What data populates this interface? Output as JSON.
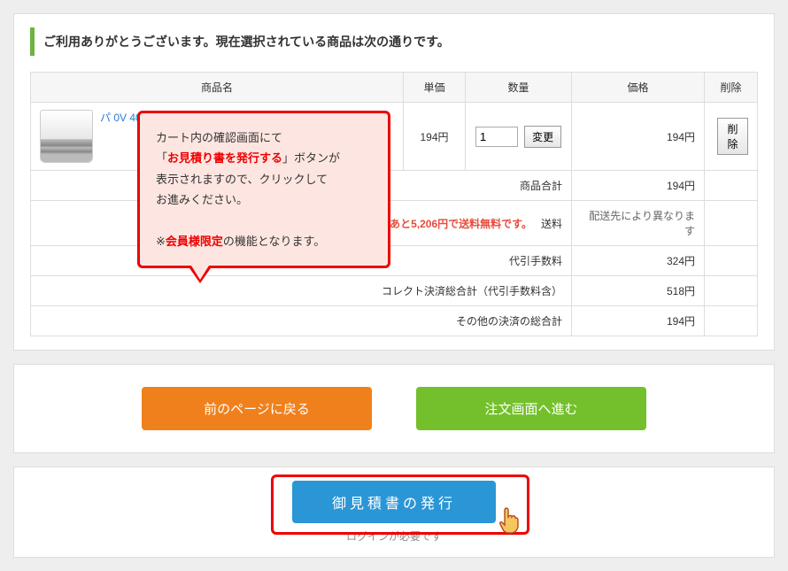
{
  "heading": "ご利用ありがとうございます。現在選択されている商品は次の通りです。",
  "table": {
    "headers": {
      "name": "商品名",
      "unit": "単価",
      "qty": "数量",
      "price": "価格",
      "del": "削除"
    },
    "item": {
      "name_visible": "パ                                                                                0V 40W形 ホワイ",
      "unit": "194円",
      "qty": "1",
      "change": "変更",
      "price": "194円",
      "del": "削除"
    },
    "summary": {
      "subtotal_label": "商品合計",
      "subtotal": "194円",
      "free_ship": "あと5,206円で送料無料です。",
      "ship_label": "送料",
      "ship_note": "配送先により異なります",
      "cod_label": "代引手数料",
      "cod": "324円",
      "collect_label": "コレクト決済総合計（代引手数料含）",
      "collect": "518円",
      "other_label": "その他の決済の総合計",
      "other": "194円"
    }
  },
  "buttons": {
    "back": "前のページに戻る",
    "next": "注文画面へ進む",
    "quote": "御見積書の発行"
  },
  "login_note": "ログインが必要です",
  "tooltip": {
    "l1": "カート内の確認画面にて",
    "l2a": "「",
    "l2b": "お見積り書を発行する",
    "l2c": "」ボタンが",
    "l3": "表示されますので、クリックして",
    "l4": "お進みください。",
    "l5a": "※",
    "l5b": "会員様限定",
    "l5c": "の機能となります。"
  }
}
